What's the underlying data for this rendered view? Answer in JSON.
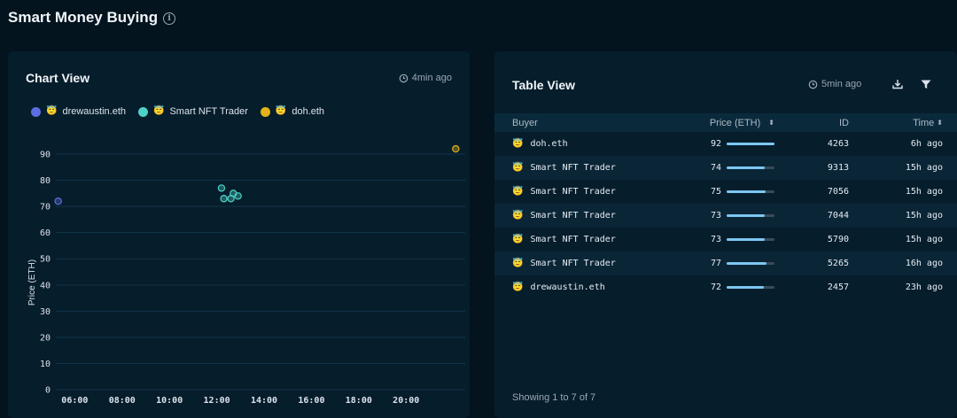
{
  "page": {
    "title": "Smart Money Buying"
  },
  "chart_panel": {
    "title": "Chart View",
    "updated": "4min ago"
  },
  "legend": [
    {
      "label": "drewaustin.eth",
      "color": "#5b6ee1"
    },
    {
      "label": "Smart NFT Trader",
      "color": "#4fd1c5"
    },
    {
      "label": "doh.eth",
      "color": "#e3b418"
    }
  ],
  "chart_data": {
    "type": "scatter",
    "ylabel": "Price (ETH)",
    "xlabel": "",
    "ylim": [
      0,
      90
    ],
    "yticks": [
      0,
      10,
      20,
      30,
      40,
      50,
      60,
      70,
      80,
      90
    ],
    "xticks": [
      "06:00",
      "08:00",
      "10:00",
      "12:00",
      "14:00",
      "16:00",
      "18:00",
      "20:00"
    ],
    "xlim_hours": [
      5.2,
      22.5
    ],
    "series": [
      {
        "name": "drewaustin.eth",
        "color": "#5b6ee1",
        "points": [
          {
            "x": 5.3,
            "y": 72
          }
        ]
      },
      {
        "name": "Smart NFT Trader",
        "color": "#4fd1c5",
        "points": [
          {
            "x": 12.2,
            "y": 77
          },
          {
            "x": 12.3,
            "y": 73
          },
          {
            "x": 12.6,
            "y": 73
          },
          {
            "x": 12.7,
            "y": 75
          },
          {
            "x": 12.9,
            "y": 74
          }
        ]
      },
      {
        "name": "doh.eth",
        "color": "#e3b418",
        "points": [
          {
            "x": 22.1,
            "y": 92
          }
        ]
      }
    ]
  },
  "table_panel": {
    "title": "Table View",
    "updated": "5min ago",
    "columns": {
      "buyer": "Buyer",
      "price": "Price (ETH)",
      "id": "ID",
      "time": "Time"
    },
    "rows": [
      {
        "buyer": "doh.eth",
        "price": "92",
        "price_pct": 100,
        "id": "4263",
        "time": "6h ago"
      },
      {
        "buyer": "Smart NFT Trader",
        "price": "74",
        "price_pct": 80,
        "id": "9313",
        "time": "15h ago"
      },
      {
        "buyer": "Smart NFT Trader",
        "price": "75",
        "price_pct": 82,
        "id": "7056",
        "time": "15h ago"
      },
      {
        "buyer": "Smart NFT Trader",
        "price": "73",
        "price_pct": 79,
        "id": "7044",
        "time": "15h ago"
      },
      {
        "buyer": "Smart NFT Trader",
        "price": "73",
        "price_pct": 79,
        "id": "5790",
        "time": "15h ago"
      },
      {
        "buyer": "Smart NFT Trader",
        "price": "77",
        "price_pct": 84,
        "id": "5265",
        "time": "16h ago"
      },
      {
        "buyer": "drewaustin.eth",
        "price": "72",
        "price_pct": 78,
        "id": "2457",
        "time": "23h ago"
      }
    ],
    "footer": "Showing 1 to 7 of 7"
  },
  "icons": {
    "buyer_emoji": "😇",
    "sort": "⬍"
  }
}
